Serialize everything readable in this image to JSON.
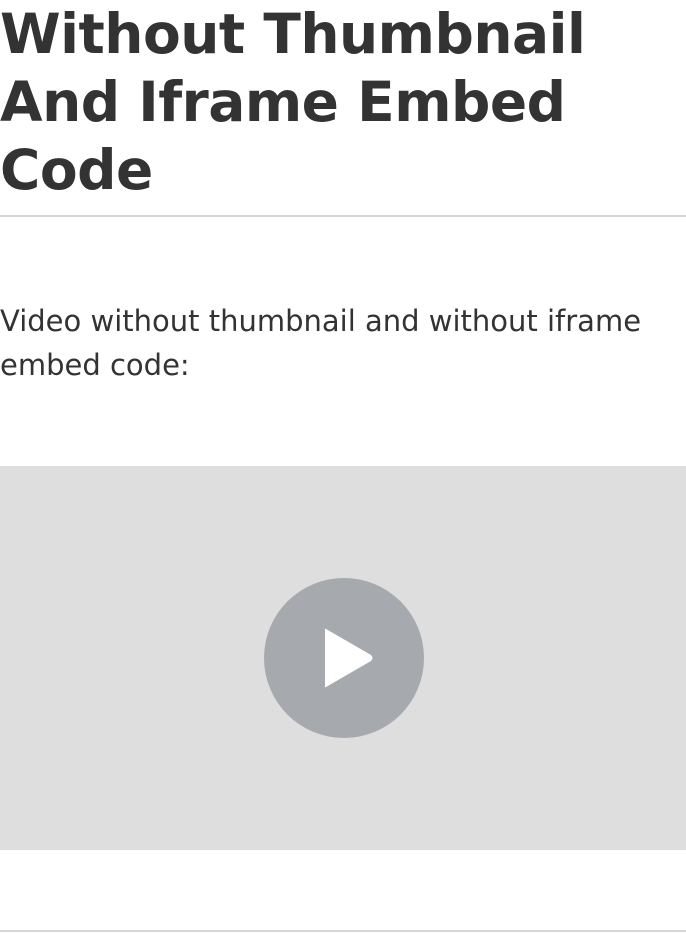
{
  "page": {
    "title": "Without Thumbnail And Iframe Embed Code",
    "description": "Video without thumbnail and without iframe embed code:"
  },
  "video": {
    "background_color": "#dedede",
    "play_button": {
      "icon": "play-icon",
      "color": "#a6a9ae",
      "icon_color": "#ffffff"
    }
  }
}
